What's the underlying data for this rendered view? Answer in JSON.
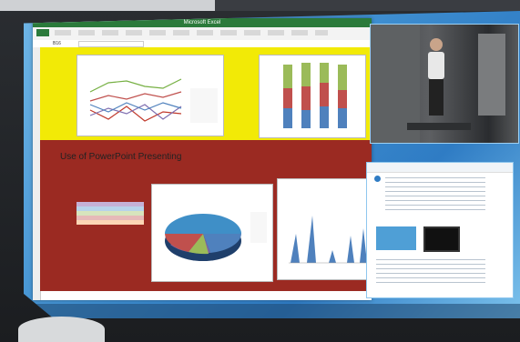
{
  "excel": {
    "title": "Microsoft Excel",
    "name_box": "B16",
    "section_title": "Use of PowerPoint Presenting"
  },
  "icons": {
    "doc_app": "circle-logo-icon",
    "excel_app": "excel-icon"
  },
  "colors": {
    "yellow_band": "#f2ea06",
    "red_band": "#9b2a22",
    "excel_green": "#2b7a3b",
    "desktop_blue": "#3e8ed0"
  }
}
